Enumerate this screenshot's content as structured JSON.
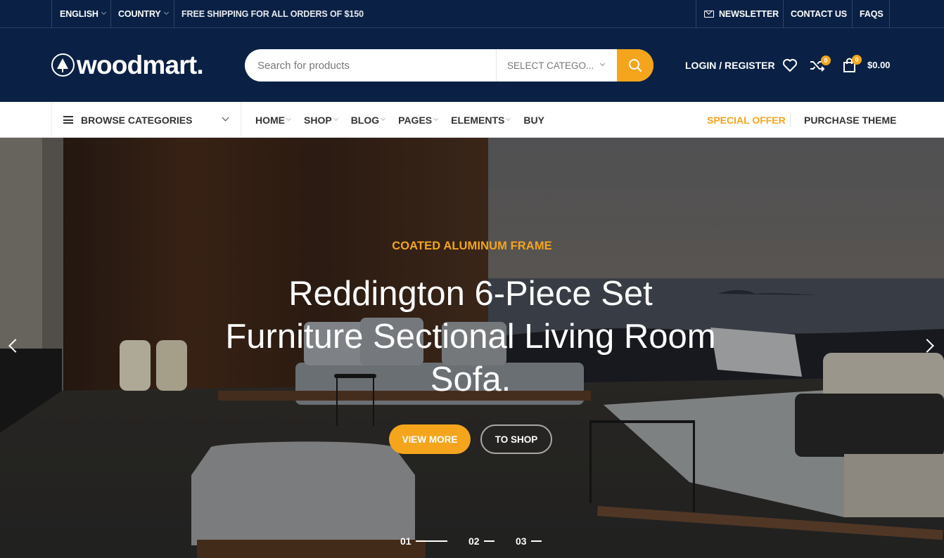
{
  "topbar": {
    "language": "ENGLISH",
    "country": "COUNTRY",
    "promo": "FREE SHIPPING FOR ALL ORDERS OF $150",
    "newsletter": "NEWSLETTER",
    "contact": "CONTACT US",
    "faqs": "FAQS"
  },
  "header": {
    "logo": "woodmart.",
    "search_placeholder": "Search for products",
    "search_value": "",
    "category_select": "SELECT CATEGO...",
    "login": "LOGIN / REGISTER",
    "compare_count": "0",
    "cart_count": "0",
    "cart_total": "$0.00"
  },
  "nav": {
    "browse": "BROWSE CATEGORIES",
    "items": [
      {
        "label": "HOME",
        "has_dropdown": true
      },
      {
        "label": "SHOP",
        "has_dropdown": true
      },
      {
        "label": "BLOG",
        "has_dropdown": true
      },
      {
        "label": "PAGES",
        "has_dropdown": true
      },
      {
        "label": "ELEMENTS",
        "has_dropdown": true
      },
      {
        "label": "BUY",
        "has_dropdown": false
      }
    ],
    "special_offer": "SPECIAL OFFER",
    "purchase": "PURCHASE THEME"
  },
  "hero": {
    "subtitle": "COATED ALUMINUM FRAME",
    "title_lines": [
      "Reddington 6-Piece Set",
      "Furniture Sectional Living Room",
      "Sofa."
    ],
    "btn_primary": "VIEW MORE",
    "btn_secondary": "TO SHOP",
    "slides": [
      {
        "label": "01",
        "active": true
      },
      {
        "label": "02",
        "active": false
      },
      {
        "label": "03",
        "active": false
      }
    ]
  },
  "colors": {
    "navy": "#0a2145",
    "accent": "#f4a51c",
    "text_dark": "#333333"
  }
}
